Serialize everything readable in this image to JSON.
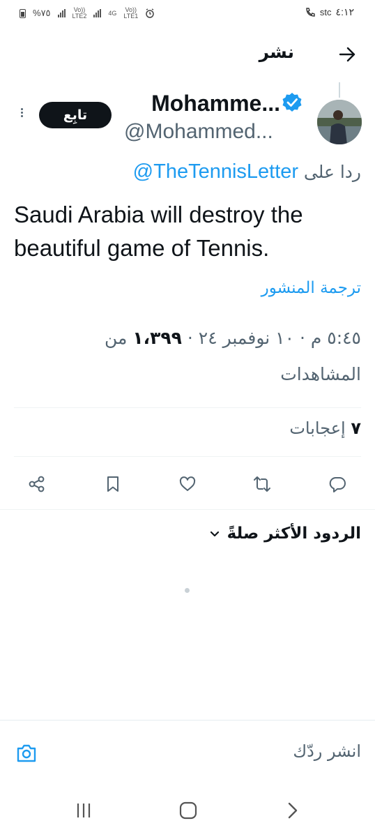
{
  "status_bar": {
    "time": "٤:١٢",
    "carrier": "stc",
    "battery": "%٧٥",
    "sim2_label": "Vo))\nLTE2",
    "sim1_net": "4G",
    "sim1_label": "Vo))\nLTE1",
    "icons": [
      "battery-icon",
      "signal-icon",
      "alarm-icon",
      "wifi-call-icon"
    ]
  },
  "header": {
    "title": "نشر",
    "back_icon": "arrow-right-icon"
  },
  "tweet": {
    "author_name": "Mohamme...",
    "author_handle": "@Mohammed...",
    "verified": true,
    "follow_label": "تابِع",
    "reply_prefix": "ردا على",
    "reply_to": "@TheTennisLetter",
    "text": "Saudi Arabia will destroy the beautiful game of Tennis.",
    "translate_label": "ترجمة المنشور",
    "timestamp": "٥:٤٥ م · ١٠ نوفمبر ٢٤ · ",
    "views_count": "١،٣٩٩",
    "views_label_1": "من",
    "views_label_2": "المشاهدات",
    "likes_count": "٧",
    "likes_label": "إعجابات"
  },
  "actions": [
    "reply-icon",
    "retweet-icon",
    "like-icon",
    "bookmark-icon",
    "share-icon"
  ],
  "replies": {
    "sort_label": "الردود الأكثر صلةً"
  },
  "compose": {
    "placeholder": "انشر ردّك"
  },
  "colors": {
    "accent": "#1d9bf0",
    "text": "#0f1419",
    "secondary": "#536471"
  }
}
